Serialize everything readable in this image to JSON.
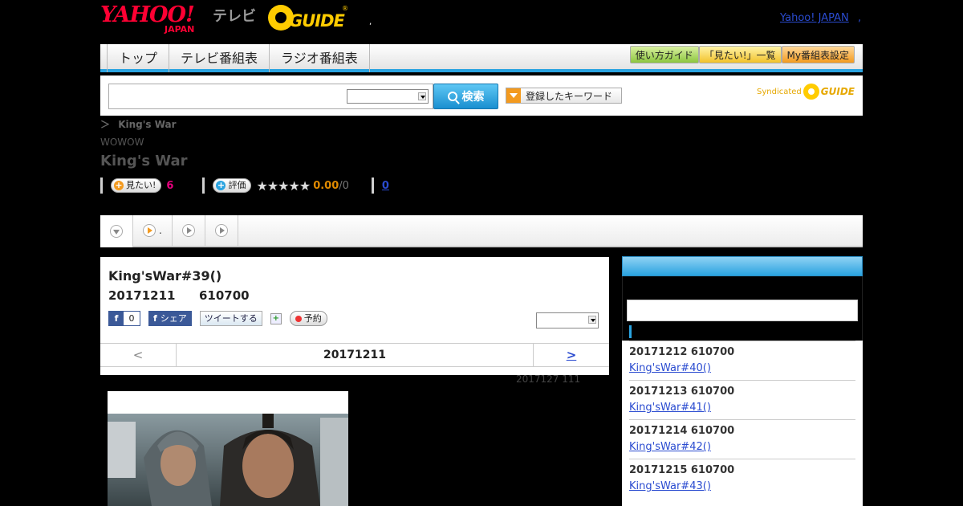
{
  "header": {
    "yahoo_logo": "YAHOO!",
    "yahoo_logo_sub": "JAPAN",
    "tv_label": "テレビ",
    "gguide_logo": "GUIDE",
    "gguide_mark": "®",
    "dot": ",",
    "yahoo_japan_link": "Yahoo! JAPAN",
    "yahoo_japan_comma": ","
  },
  "nav": {
    "tabs": [
      "トップ",
      "テレビ番組表",
      "ラジオ番組表"
    ],
    "right_buttons": [
      "使い方ガイド",
      "「見たい!」一覧",
      "My番組表設定"
    ]
  },
  "search": {
    "input_value": "",
    "select_value": "",
    "button_label": "検索",
    "keyword_button": "登録したキーワード",
    "syndicated_label": "Syndicated",
    "syndicated_logo": "GUIDE"
  },
  "program": {
    "breadcrumb_sep": "＞",
    "breadcrumb": "King's War",
    "channel": "WOWOW",
    "title": "King's War",
    "want_label": "見たい!",
    "want_count": "6",
    "rate_label": "評価",
    "stars": "★★★★★",
    "score": "0.00",
    "score_den": "/0",
    "review_count": "0"
  },
  "tabstrip": {
    "tab2_label": "."
  },
  "episode": {
    "title": "King'sWar#39()",
    "date": "20171211",
    "time": "610700",
    "fb_like_count": "0",
    "fb_share": "シェア",
    "tweet": "ツイートする",
    "reserve": "予約",
    "select_value": "",
    "prev": "<",
    "nav_date": "20171211",
    "next": ">",
    "update_note": "2017127  111"
  },
  "sidebar": {
    "items": [
      {
        "date": "20171212  610700",
        "link": "King'sWar#40()"
      },
      {
        "date": "20171213  610700",
        "link": "King'sWar#41()"
      },
      {
        "date": "20171214  610700",
        "link": "King'sWar#42()"
      },
      {
        "date": "20171215  610700",
        "link": "King'sWar#43()"
      }
    ]
  },
  "colors": {
    "accent_blue": "#2aa3e0",
    "yahoo_red": "#ff0033",
    "gguide_yellow": "#ffcc00",
    "link_blue": "#2a4bd0"
  }
}
